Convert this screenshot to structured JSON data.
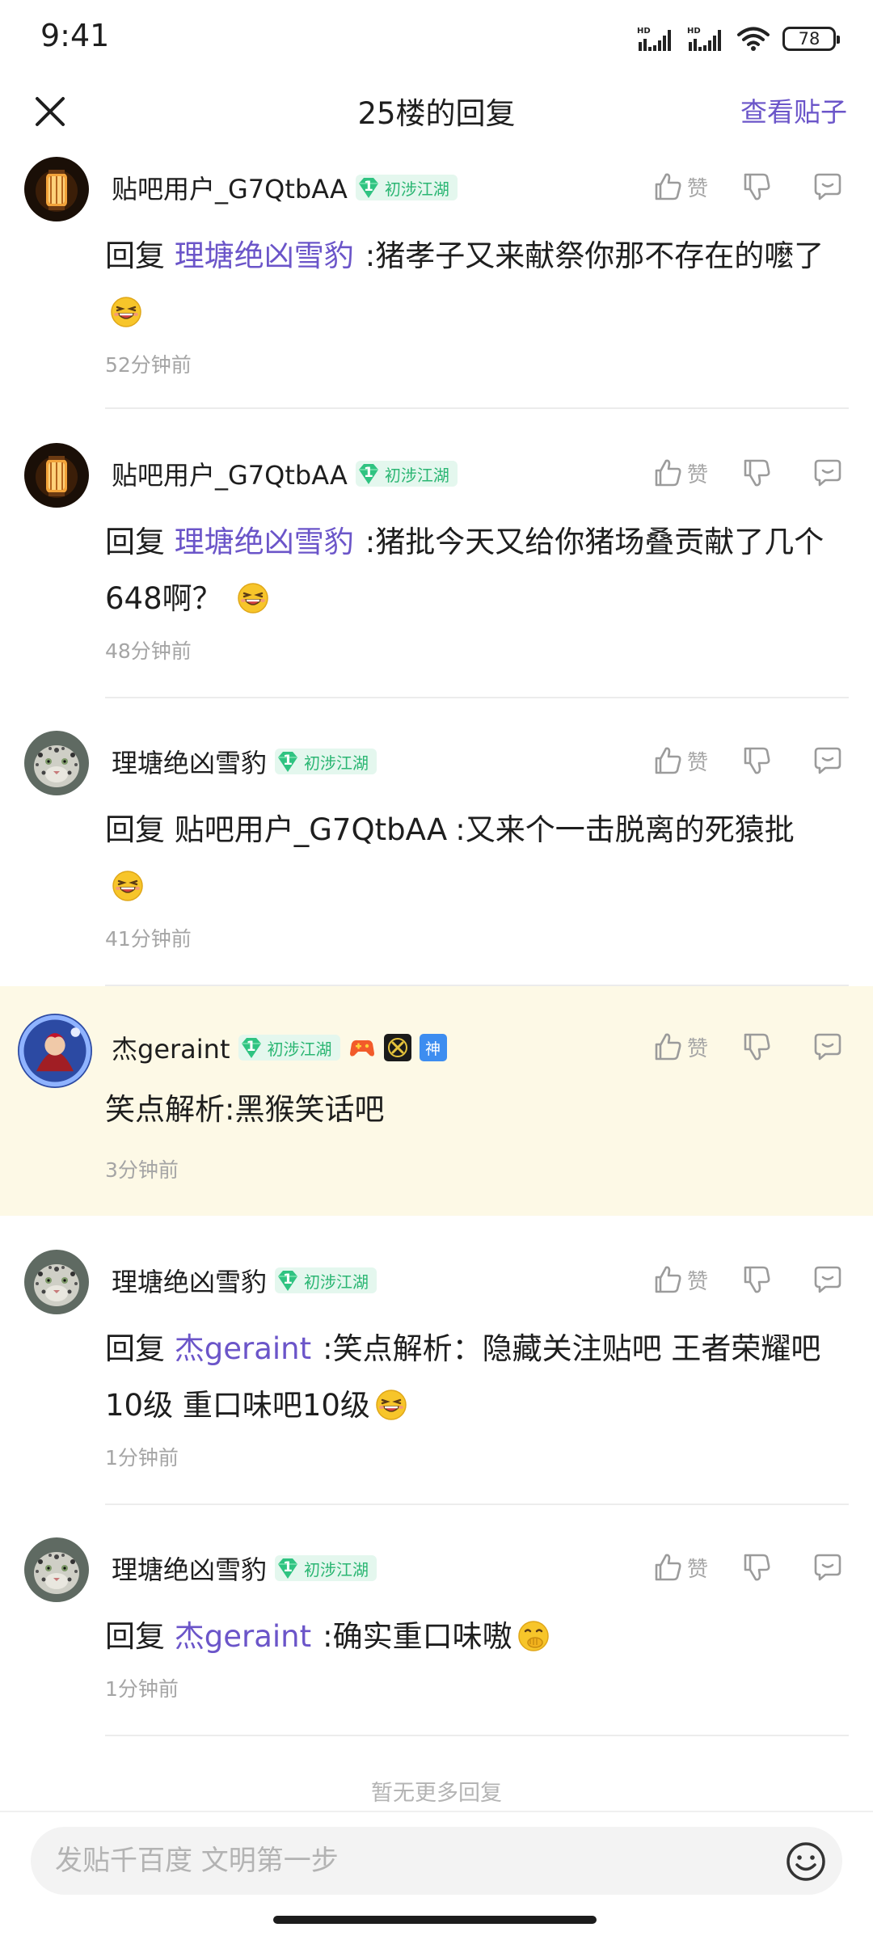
{
  "status_bar": {
    "time": "9:41",
    "battery": "78"
  },
  "header": {
    "title": "25楼的回复",
    "view_post_label": "查看贴子"
  },
  "actions": {
    "like_label": "赞"
  },
  "replies": [
    {
      "username": "贴吧用户_G7QtbAA",
      "level": "1",
      "level_name": "初涉江湖",
      "prefix": "回复",
      "mention": "理塘绝凶雪豹",
      "text": ":猪孝子又来献祭你那不存在的嚒了",
      "time": "52分钟前"
    },
    {
      "username": "贴吧用户_G7QtbAA",
      "level": "1",
      "level_name": "初涉江湖",
      "prefix": "回复",
      "mention": "理塘绝凶雪豹",
      "text": ":猪批今天又给你猪场叠贡献了几个648啊？",
      "time": "48分钟前"
    },
    {
      "username": "理塘绝凶雪豹",
      "level": "1",
      "level_name": "初涉江湖",
      "prefix": "回复",
      "mention": "贴吧用户_G7QtbAA",
      "text": ":又来个一击脱离的死猿批",
      "time": "41分钟前"
    },
    {
      "username": "杰geraint",
      "level": "1",
      "level_name": "初涉江湖",
      "badge_text": "神",
      "text": "笑点解析:黑猴笑话吧",
      "time": "3分钟前"
    },
    {
      "username": "理塘绝凶雪豹",
      "level": "1",
      "level_name": "初涉江湖",
      "prefix": "回复",
      "mention": "杰geraint",
      "text": ":笑点解析：隐藏关注贴吧 王者荣耀吧10级 重口味吧10级",
      "time": "1分钟前"
    },
    {
      "username": "理塘绝凶雪豹",
      "level": "1",
      "level_name": "初涉江湖",
      "prefix": "回复",
      "mention": "杰geraint",
      "text": ":确实重口味嗷",
      "time": "1分钟前"
    }
  ],
  "footer": {
    "no_more": "暂无更多回复",
    "input_placeholder": "发贴千百度 文明第一步"
  }
}
